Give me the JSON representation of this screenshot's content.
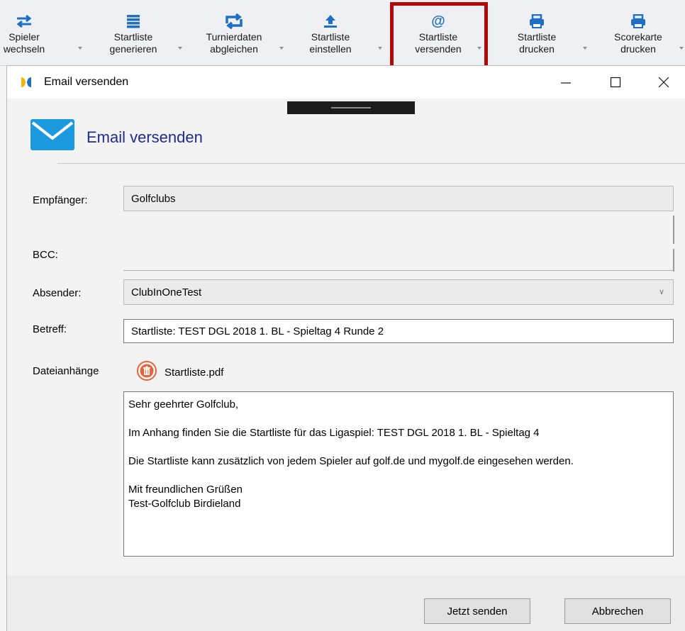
{
  "toolbar": {
    "buttons": [
      {
        "line1": "Spieler",
        "line2": "wechseln"
      },
      {
        "line1": "Startliste",
        "line2": "generieren"
      },
      {
        "line1": "Turnierdaten",
        "line2": "abgleichen"
      },
      {
        "line1": "Startliste",
        "line2": "einstellen"
      },
      {
        "line1": "Startliste",
        "line2": "versenden"
      },
      {
        "line1": "Startliste",
        "line2": "drucken"
      },
      {
        "line1": "Scorekarte",
        "line2": "drucken"
      }
    ],
    "icon_color": "#1f6fc5",
    "highlight_color": "#b10a0a"
  },
  "dialog": {
    "window_title": "Email versenden",
    "heading": "Email versenden",
    "heading_color": "#1f2b8f",
    "labels": {
      "recipient": "Empfänger:",
      "bcc": "BCC:",
      "sender": "Absender:",
      "subject": "Betreff:",
      "attachments": "Dateianhänge"
    },
    "values": {
      "recipient": "Golfclubs",
      "bcc": "",
      "sender": "ClubInOneTest",
      "subject": "Startliste: TEST DGL 2018 1. BL  - Spieltag 4 Runde 2",
      "attachment_name": "Startliste.pdf"
    },
    "body": {
      "greeting": "Sehr geehrter Golfclub,",
      "line1": "Im Anhang finden Sie die Startliste für das Ligaspiel: TEST DGL 2018 1. BL  - Spieltag 4",
      "line2": "Die Startliste kann zusätzlich von jedem Spieler auf golf.de und mygolf.de eingesehen werden.",
      "closing": "Mit freundlichen Grüßen",
      "signature": "Test-Golfclub Birdieland"
    },
    "buttons": {
      "send": "Jetzt senden",
      "cancel": "Abbrechen"
    }
  }
}
